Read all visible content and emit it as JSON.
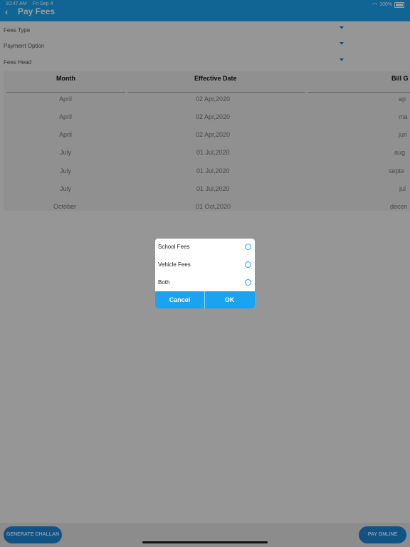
{
  "status": {
    "time": "10:47 AM",
    "date": "Fri Sep 4",
    "wifi": "wifi-icon",
    "battery": "100%"
  },
  "header": {
    "title": "Pay Fees"
  },
  "form": {
    "fees_type": "Fees Type",
    "payment_option": "Payment Option",
    "fees_head": "Fees Head"
  },
  "table": {
    "headers": [
      "Month",
      "Effective Date",
      "Bill G"
    ],
    "rows": [
      [
        "April",
        "02 Apr,2020",
        "ap"
      ],
      [
        "April",
        "02 Apr,2020",
        "ma"
      ],
      [
        "April",
        "02 Apr,2020",
        "jun"
      ],
      [
        "July",
        "01 Jul,2020",
        "aug"
      ],
      [
        "July",
        "01 Jul,2020",
        "septe"
      ],
      [
        "July",
        "01 Jul,2020",
        "jul"
      ],
      [
        "October",
        "01 Oct,2020",
        "decen"
      ]
    ]
  },
  "dialog": {
    "options": [
      "School Fees",
      "Vehicle Fees",
      "Both"
    ],
    "cancel": "Cancel",
    "ok": "OK"
  },
  "bottom": {
    "generate": "GENERATE CHALLAN",
    "pay": "PAY ONLINE"
  },
  "colors": {
    "accent": "#1aa3f0",
    "button": "#1a86d8"
  }
}
